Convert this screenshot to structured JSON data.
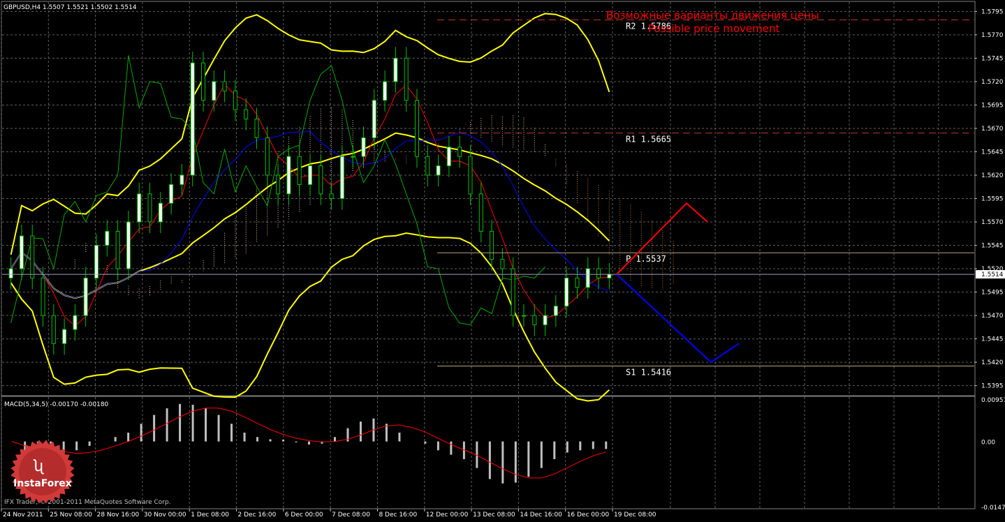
{
  "header": {
    "symbol_line": "GBPUSD,H4  1.5507 1.5521 1.5502 1.5514",
    "title_ru": "Возможные варианты движения цены",
    "title_en": "Possible price movement"
  },
  "levels": [
    {
      "label": "R2 1.5786",
      "price": 1.5786,
      "color": "#c0392b"
    },
    {
      "label": "R1 1.5665",
      "price": 1.5665,
      "color": "#c0392b"
    },
    {
      "label": "P 1.5537",
      "price": 1.5537,
      "color": "#b9a47a"
    },
    {
      "label": "S1 1.5416",
      "price": 1.5416,
      "color": "#b9a47a"
    }
  ],
  "current_price": "1.5514",
  "price_axis": [
    "1.5795",
    "1.5770",
    "1.5745",
    "1.5720",
    "1.5695",
    "1.5670",
    "1.5645",
    "1.5620",
    "1.5595",
    "1.5570",
    "1.5545",
    "1.5520",
    "1.5495",
    "1.5470",
    "1.5445",
    "1.5420",
    "1.5395"
  ],
  "time_axis": [
    "24 Nov 2011",
    "25 Nov 08:00",
    "28 Nov 16:00",
    "30 Nov 00:00",
    "1 Dec 08:00",
    "2 Dec 16:00",
    "6 Dec 00:00",
    "7 Dec 08:00",
    "8 Dec 16:00",
    "12 Dec 00:00",
    "13 Dec 08:00",
    "14 Dec 16:00",
    "16 Dec 00:00",
    "19 Dec 08:00"
  ],
  "macd": {
    "label": "MACD(5,34,5) -0.00170 -0.00180",
    "axis": [
      "0.00957",
      "0.00",
      "-0.01475"
    ]
  },
  "footer": {
    "copyright": "IFX Trader, © 2001-2011 MetaQuotes Software Corp.",
    "logo_text": "InstaForex"
  },
  "colors": {
    "up_candle": "#ffffff",
    "down_candle": "#000000",
    "candle_wick": "#00c000",
    "bollinger": "#ffff00",
    "tenkan": "#ff0000",
    "kijun": "#0000ff",
    "chikou": "#00aa00",
    "forecast_up": "#ff0000",
    "forecast_down": "#0000ff",
    "macd_hist": "#c0c0c0",
    "macd_signal": "#ff0000",
    "grid": "#606060"
  },
  "chart_data": {
    "type": "candlestick",
    "symbol": "GBPUSD",
    "timeframe": "H4",
    "ylim": [
      1.5385,
      1.5805
    ],
    "last": {
      "open": 1.5507,
      "high": 1.5521,
      "low": 1.5502,
      "close": 1.5514
    },
    "closes_approx": [
      1.552,
      1.5555,
      1.551,
      1.547,
      1.544,
      1.5455,
      1.547,
      1.551,
      1.5545,
      1.556,
      1.552,
      1.557,
      1.56,
      1.557,
      1.559,
      1.561,
      1.562,
      1.574,
      1.57,
      1.572,
      1.571,
      1.569,
      1.568,
      1.566,
      1.562,
      1.56,
      1.564,
      1.561,
      1.563,
      1.56,
      1.5595,
      1.564,
      1.564,
      1.566,
      1.57,
      1.572,
      1.5745,
      1.57,
      1.564,
      1.562,
      1.563,
      1.565,
      1.564,
      1.56,
      1.556,
      1.553,
      1.552,
      1.547,
      1.547,
      1.546,
      1.547,
      1.548,
      1.551,
      1.55,
      1.552,
      1.551,
      1.5514
    ],
    "forecast": {
      "bullish": [
        1.5514,
        1.559,
        1.557
      ],
      "bearish": [
        1.5514,
        1.542,
        1.544
      ]
    },
    "macd_hist_approx": [
      0.0,
      -0.002,
      -0.003,
      -0.0035,
      -0.003,
      -0.002,
      -0.001,
      0.0,
      0.001,
      0.002,
      0.004,
      0.006,
      0.0075,
      0.0085,
      0.0083,
      0.0075,
      0.006,
      0.004,
      0.002,
      0.001,
      0.0005,
      0.0004,
      -0.0002,
      -0.0007,
      -0.0005,
      0.001,
      0.003,
      0.0045,
      0.0052,
      0.004,
      0.002,
      0.0,
      -0.0005,
      -0.002,
      -0.003,
      -0.004,
      -0.006,
      -0.0085,
      -0.0095,
      -0.0093,
      -0.008,
      -0.006,
      -0.004,
      -0.0025,
      -0.002,
      -0.0017,
      -0.0017
    ]
  }
}
